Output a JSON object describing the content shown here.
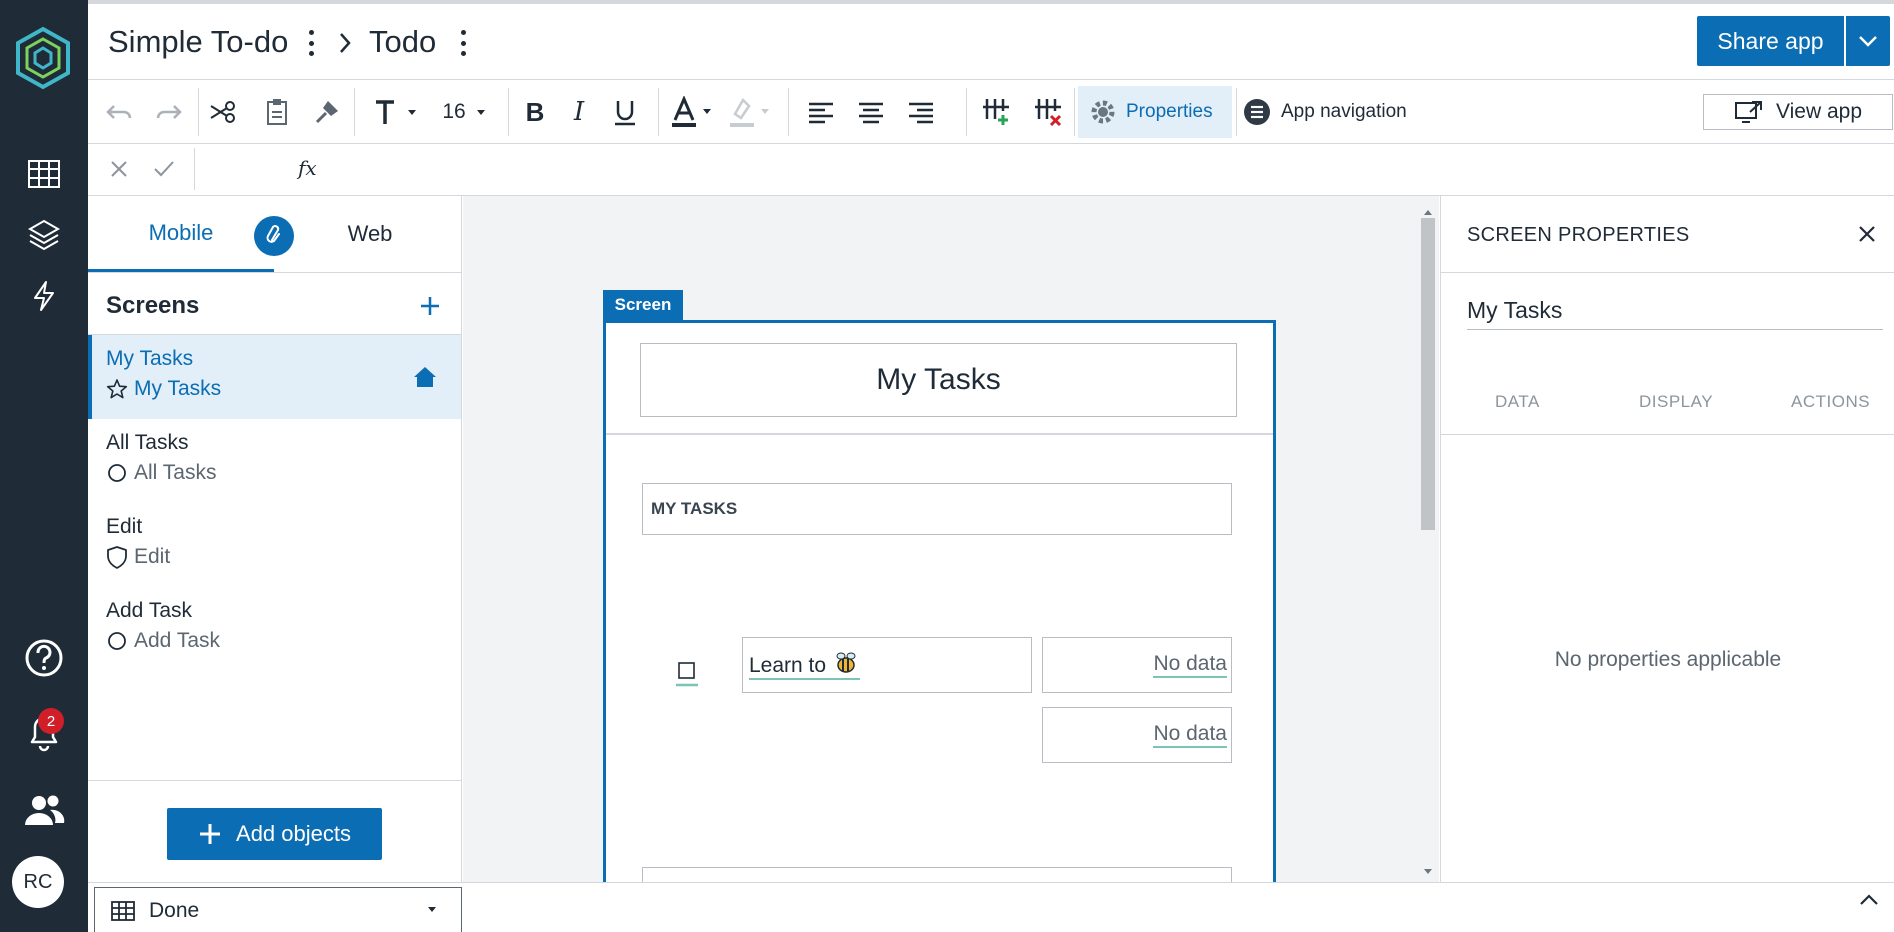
{
  "header": {
    "app_name": "Simple To-do",
    "separator": ">",
    "screen_name": "Todo",
    "share_label": "Share app"
  },
  "rail": {
    "notification_count": "2",
    "avatar_initials": "RC"
  },
  "toolbar": {
    "font_size": "16",
    "properties_label": "Properties",
    "app_navigation_label": "App navigation",
    "view_app_label": "View app",
    "text_color": "#1f2b37",
    "highlight_color": "#c7ccd1"
  },
  "formula": {
    "fx_label": "fx"
  },
  "screens_panel": {
    "tabs": [
      {
        "label": "Mobile",
        "active": true
      },
      {
        "label": "Web",
        "active": false
      }
    ],
    "title": "Screens",
    "items": [
      {
        "name": "My Tasks",
        "subtitle": "My Tasks",
        "icon": "star-icon",
        "selected": true,
        "home": true
      },
      {
        "name": "All Tasks",
        "subtitle": "All Tasks",
        "icon": "circle-icon",
        "selected": false
      },
      {
        "name": "Edit",
        "subtitle": "Edit",
        "icon": "shield-icon",
        "selected": false
      },
      {
        "name": "Add Task",
        "subtitle": "Add Task",
        "icon": "circle-icon",
        "selected": false
      }
    ],
    "add_objects_label": "Add objects"
  },
  "canvas": {
    "screen_tag": "Screen",
    "title": "My Tasks",
    "section_label": "MY TASKS",
    "task_text": "Learn to",
    "no_data_1": "No data",
    "no_data_2": "No data"
  },
  "properties_panel": {
    "title": "SCREEN PROPERTIES",
    "screen_name_value": "My Tasks",
    "tabs": [
      "DATA",
      "DISPLAY",
      "ACTIONS"
    ],
    "empty_message": "No properties applicable"
  },
  "bottom_bar": {
    "view_label": "Done"
  },
  "colors": {
    "accent": "#0b6db3",
    "rail_bg": "#1f2b37",
    "selected_bg": "#e2eef8",
    "badge": "#d11f2a"
  }
}
